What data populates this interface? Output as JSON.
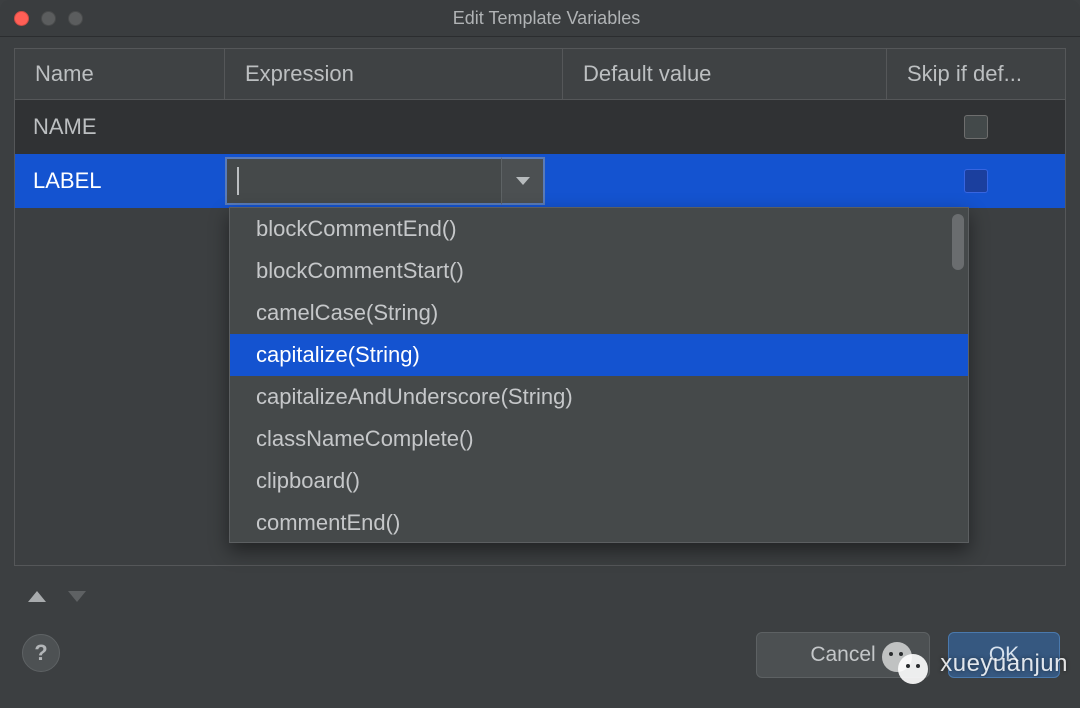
{
  "window": {
    "title": "Edit Template Variables"
  },
  "columns": {
    "name": "Name",
    "expression": "Expression",
    "default_value": "Default value",
    "skip_if_defined": "Skip if def..."
  },
  "rows": [
    {
      "name": "NAME",
      "expression": "",
      "default": "",
      "skip": false,
      "selected": false
    },
    {
      "name": "LABEL",
      "expression": "",
      "default": "",
      "skip": false,
      "selected": true
    }
  ],
  "expression_editor": {
    "value": "",
    "placeholder": ""
  },
  "suggestions": {
    "selected_index": 3,
    "items": [
      "blockCommentEnd()",
      "blockCommentStart()",
      "camelCase(String)",
      "capitalize(String)",
      "capitalizeAndUnderscore(String)",
      "classNameComplete()",
      "clipboard()",
      "commentEnd()"
    ]
  },
  "buttons": {
    "cancel": "Cancel",
    "ok": "OK",
    "help": "?"
  },
  "watermark": {
    "text": "xueyuanjun"
  }
}
